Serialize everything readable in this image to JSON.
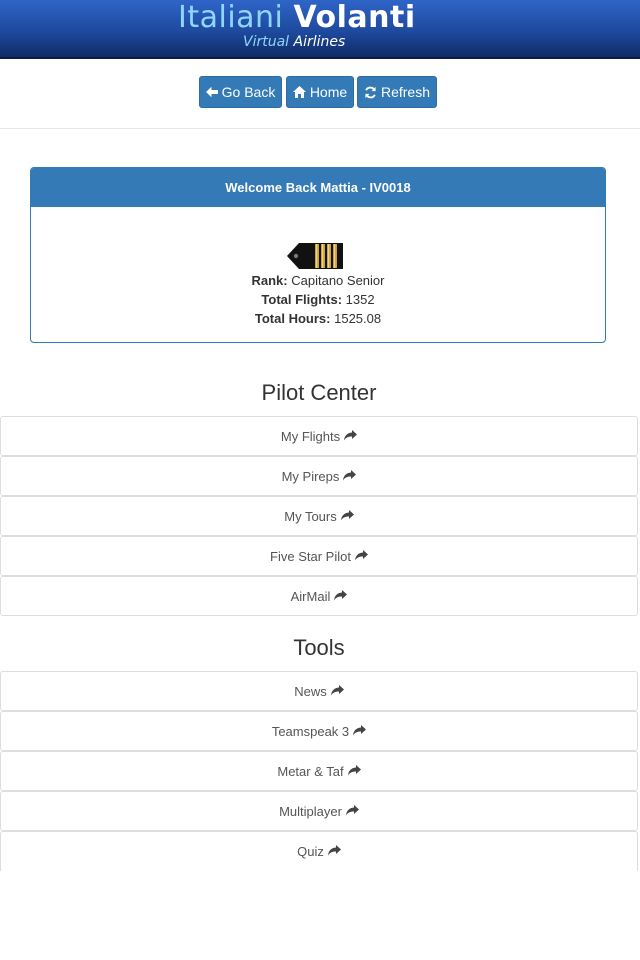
{
  "header": {
    "logo_word1": "Italiani",
    "logo_word2": "Volanti",
    "logo_sub1": "Virtual",
    "logo_sub2": "Airlines"
  },
  "toolbar": {
    "back_label": "Go Back",
    "home_label": "Home",
    "refresh_label": "Refresh"
  },
  "welcome": {
    "title": "Welcome Back Mattia - IV0018",
    "rank_label": "Rank:",
    "rank_value": "Capitano Senior",
    "flights_label": "Total Flights:",
    "flights_value": "1352",
    "hours_label": "Total Hours:",
    "hours_value": "1525.08",
    "rank_icon": "captain-epaulette-icon"
  },
  "pilot_center": {
    "title": "Pilot Center",
    "items": [
      {
        "label": "My Flights"
      },
      {
        "label": "My Pireps"
      },
      {
        "label": "My Tours"
      },
      {
        "label": "Five Star Pilot"
      },
      {
        "label": "AirMail"
      }
    ]
  },
  "tools": {
    "title": "Tools",
    "items": [
      {
        "label": "News"
      },
      {
        "label": "Teamspeak 3"
      },
      {
        "label": "Metar & Taf"
      },
      {
        "label": "Multiplayer"
      },
      {
        "label": "Quiz"
      }
    ]
  },
  "colors": {
    "primary": "#337ab7",
    "header_top": "#2f64c8",
    "header_bottom": "#0f2c66",
    "logo_accent": "#8fd6ff"
  }
}
